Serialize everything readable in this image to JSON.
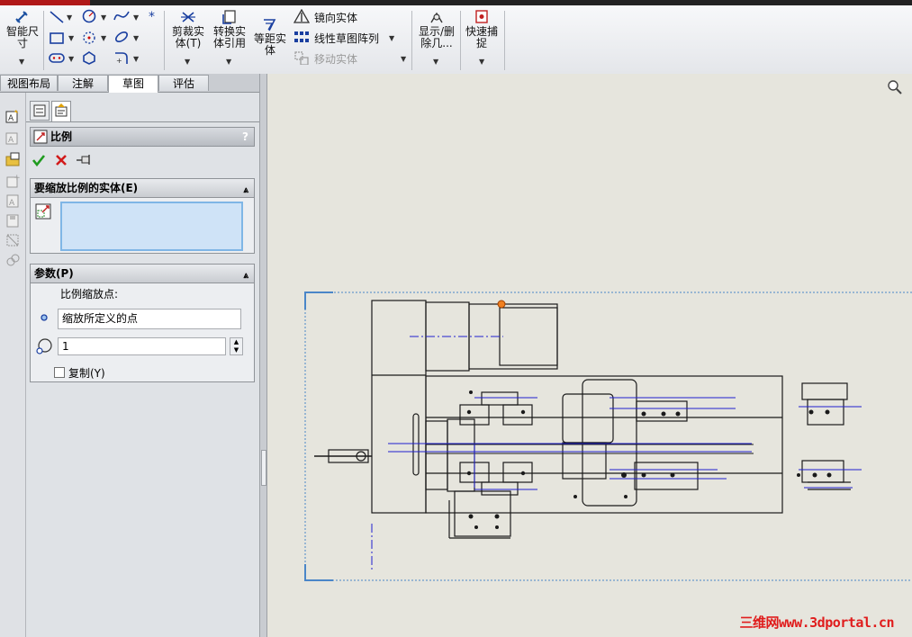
{
  "ribbon": {
    "smart_dimension": "智能尺寸",
    "trim": "剪裁实体(T)",
    "convert": "转换实体引用",
    "offset": "等距实体",
    "mirror": "镜向实体",
    "linear_pattern": "线性草图阵列",
    "move": "移动实体",
    "show_delete": "显示/删除几...",
    "quick_snap": "快速捕捉"
  },
  "tabs": [
    {
      "label": "视图布局"
    },
    {
      "label": "注解"
    },
    {
      "label": "草图"
    },
    {
      "label": "评估"
    }
  ],
  "property_manager": {
    "title": "比例",
    "help": "?",
    "section_entities": "要缩放比例的实体(E)",
    "section_params": "参数(P)",
    "scale_point_label": "比例缩放点:",
    "scale_point_value": "缩放所定义的点",
    "scale_factor": "1",
    "copy_label": "复制(Y)"
  },
  "watermark": "三维网www.3dportal.cn",
  "colors": {
    "ok": "#1f9b1f",
    "cancel": "#d21a1a",
    "selection_box": "#cfe3f7",
    "sketch_line": "#1a1a1a",
    "construction_line": "#2020d0",
    "canvas": "#e6e5dd"
  }
}
